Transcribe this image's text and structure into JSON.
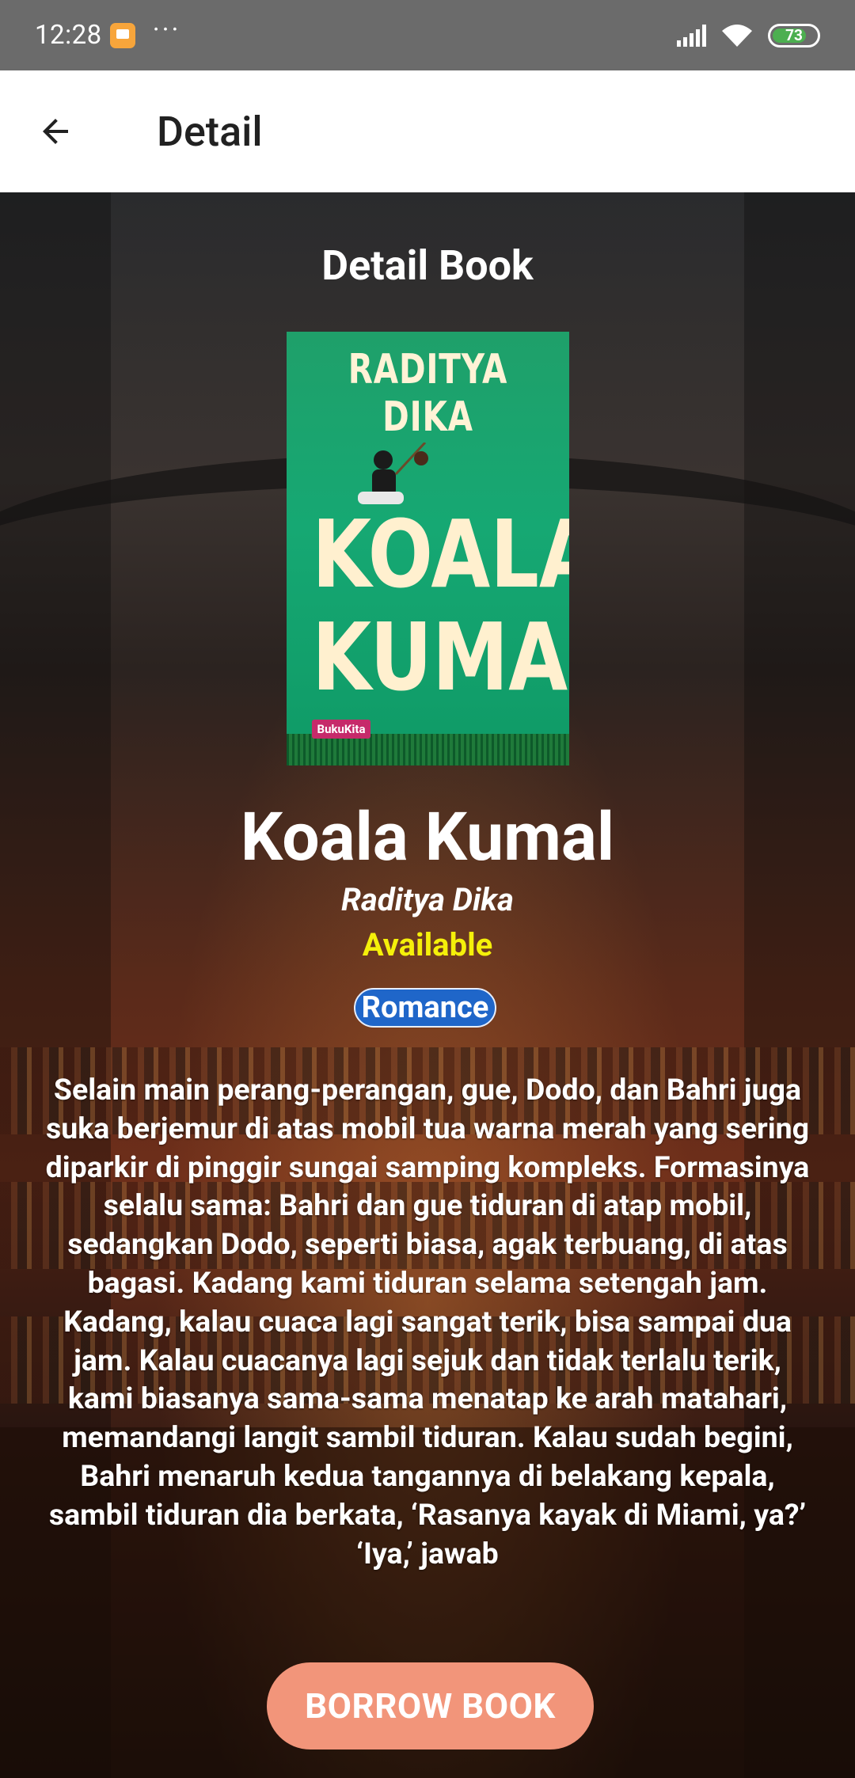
{
  "status_bar": {
    "time": "12:28",
    "battery_level": "73",
    "notification_icon": "app-notification-icon",
    "overflow_icon": "more-dots-icon"
  },
  "app_bar": {
    "title": "Detail",
    "back_icon": "arrow-back-icon"
  },
  "page": {
    "section_title": "Detail Book"
  },
  "book": {
    "cover": {
      "author_text": "RADITYA DIKA",
      "title_line_1": "KOALA",
      "title_line_2": "KUMAL",
      "publisher_logo": "BukuKita"
    },
    "title": "Koala Kumal",
    "author": "Raditya Dika",
    "status": "Available",
    "genre": "Romance",
    "description": "Selain main perang-perangan, gue, Dodo, dan Bahri juga suka berjemur di atas mobil tua warna merah yang sering diparkir di pinggir sungai samping kompleks. Formasinya selalu sama: Bahri dan gue tiduran di atap mobil, sedangkan Dodo, seperti biasa, agak terbuang, di atas bagasi. Kadang kami tiduran selama setengah jam. Kadang, kalau cuaca lagi sangat terik, bisa sampai dua jam. Kalau cuacanya lagi sejuk dan tidak terlalu terik, kami biasanya sama-sama menatap ke arah matahari, memandangi langit sambil tiduran. Kalau sudah begini, Bahri menaruh kedua tangannya di belakang kepala, sambil tiduran dia berkata, ‘Rasanya kayak di Miami, ya?’ ‘Iya,’ jawab"
  },
  "actions": {
    "borrow_label": "BORROW BOOK"
  },
  "colors": {
    "status_bar": "#6b6b6b",
    "app_bar": "#ffffff",
    "status_available": "#f5f00a",
    "genre_badge": "#1f66c9",
    "borrow_button": "#f2957a",
    "battery": "#4caf50"
  }
}
